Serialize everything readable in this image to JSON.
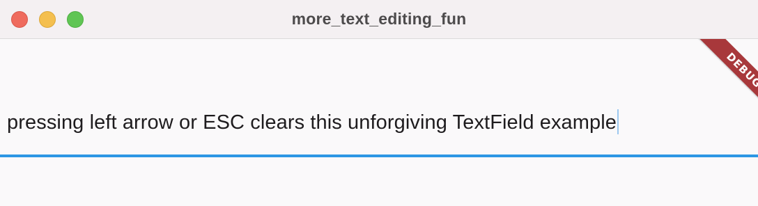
{
  "window": {
    "title": "more_text_editing_fun",
    "buttons": {
      "close": "close-window",
      "minimize": "minimize-window",
      "zoom": "zoom-window"
    }
  },
  "textfield": {
    "value": "pressing left arrow or ESC clears this unforgiving TextField example",
    "underline_color": "#2d97e4",
    "caret_color": "#9cc8f0"
  },
  "debug_banner": {
    "label": "DEBUG",
    "color": "#a8383b"
  },
  "colors": {
    "close": "#ef6b5e",
    "minimize": "#f4bf4f",
    "zoom": "#60c554"
  }
}
